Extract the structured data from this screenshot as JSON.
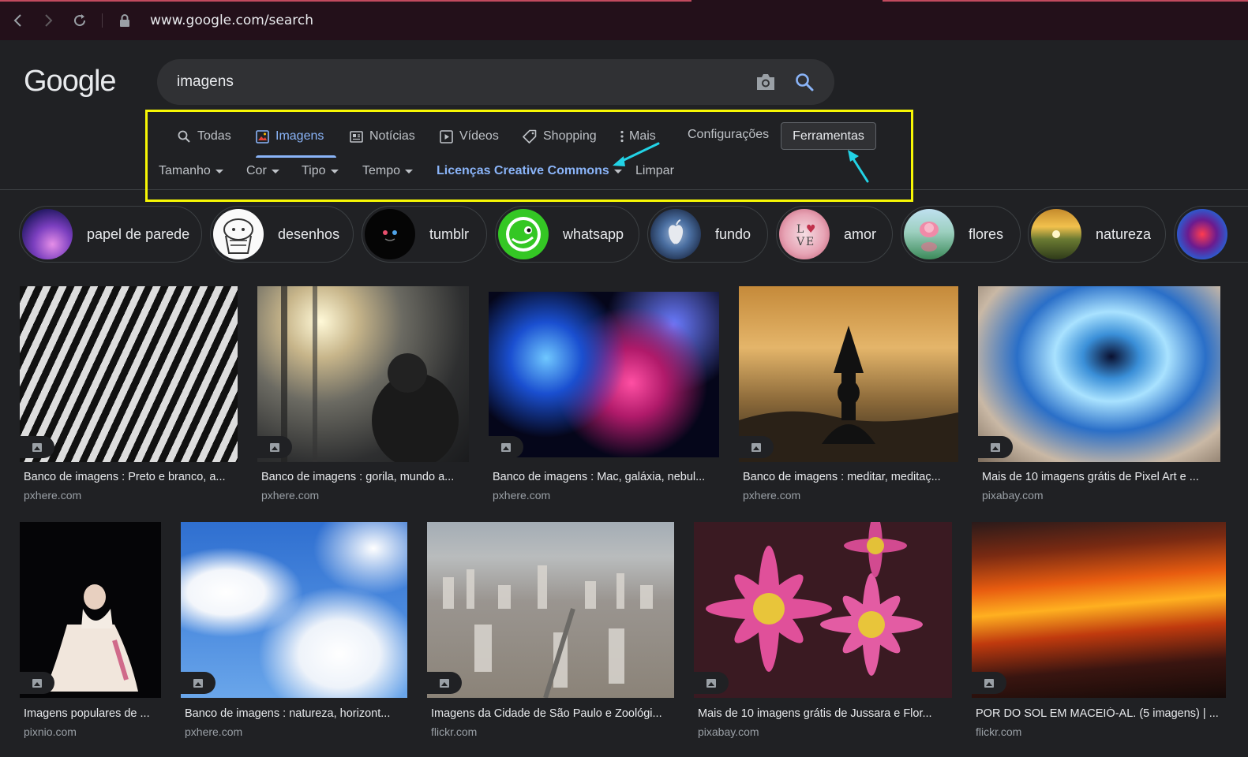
{
  "browser": {
    "url": "www.google.com/search"
  },
  "logo": "Google",
  "search": {
    "query": "imagens"
  },
  "tabs": [
    {
      "label": "Todas",
      "icon": "search-icon"
    },
    {
      "label": "Imagens",
      "icon": "image-icon"
    },
    {
      "label": "Notícias",
      "icon": "news-icon"
    },
    {
      "label": "Vídeos",
      "icon": "play-icon"
    },
    {
      "label": "Shopping",
      "icon": "tag-icon"
    },
    {
      "label": "Mais",
      "icon": "more-vert-icon"
    }
  ],
  "settings_label": "Configurações",
  "tools_label": "Ferramentas",
  "filters": [
    {
      "label": "Tamanho"
    },
    {
      "label": "Cor"
    },
    {
      "label": "Tipo"
    },
    {
      "label": "Tempo"
    },
    {
      "label": "Licenças Creative Commons"
    }
  ],
  "clear_label": "Limpar",
  "chips": [
    {
      "label": "papel de parede"
    },
    {
      "label": "desenhos"
    },
    {
      "label": "tumblr"
    },
    {
      "label": "whatsapp"
    },
    {
      "label": "fundo"
    },
    {
      "label": "amor"
    },
    {
      "label": "flores"
    },
    {
      "label": "natureza"
    }
  ],
  "results": [
    {
      "caption": "Banco de imagens : Preto e branco, a...",
      "source": "pxhere.com"
    },
    {
      "caption": "Banco de imagens : gorila, mundo a...",
      "source": "pxhere.com"
    },
    {
      "caption": "Banco de imagens : Mac, galáxia, nebul...",
      "source": "pxhere.com"
    },
    {
      "caption": "Banco de imagens : meditar, meditaç...",
      "source": "pxhere.com"
    },
    {
      "caption": "Mais de 10 imagens grátis de Pixel Art e ...",
      "source": "pixabay.com"
    },
    {
      "caption": "Imagens populares de ...",
      "source": "pixnio.com"
    },
    {
      "caption": "Banco de imagens : natureza, horizont...",
      "source": "pxhere.com"
    },
    {
      "caption": "Imagens da Cidade de São Paulo e Zoológi...",
      "source": "flickr.com"
    },
    {
      "caption": "Mais de 10 imagens grátis de Jussara e Flor...",
      "source": "pixabay.com"
    },
    {
      "caption": "POR DO SOL EM MACEIÓ-AL. (5 imagens) | ...",
      "source": "flickr.com"
    }
  ],
  "colors": {
    "accent": "#8ab4f8",
    "highlight": "#f7f704",
    "annotation_arrow": "#22d3e6"
  }
}
